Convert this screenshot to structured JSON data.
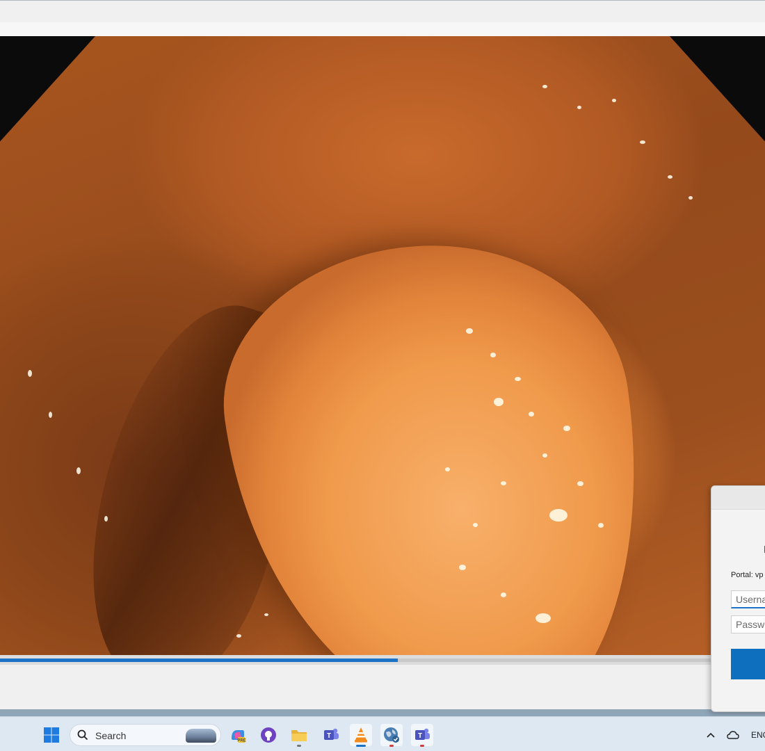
{
  "player": {
    "progress_fraction": 0.52
  },
  "vpn_dialog": {
    "portal_label": "Portal: vp",
    "username_placeholder": "Userna",
    "password_placeholder": "Passwo"
  },
  "taskbar": {
    "search_placeholder": "Search",
    "tray_language": "ENG",
    "apps": [
      {
        "icon": "windows-start-icon"
      },
      {
        "icon": "copilot-icon"
      },
      {
        "icon": "github-icon"
      },
      {
        "icon": "file-explorer-icon"
      },
      {
        "icon": "teams-icon"
      },
      {
        "icon": "vlc-icon"
      },
      {
        "icon": "vpn-globe-icon"
      },
      {
        "icon": "teams-alt-icon"
      }
    ]
  },
  "colors": {
    "accent": "#1a73c6",
    "taskbar_bg": "#dde8f3"
  }
}
